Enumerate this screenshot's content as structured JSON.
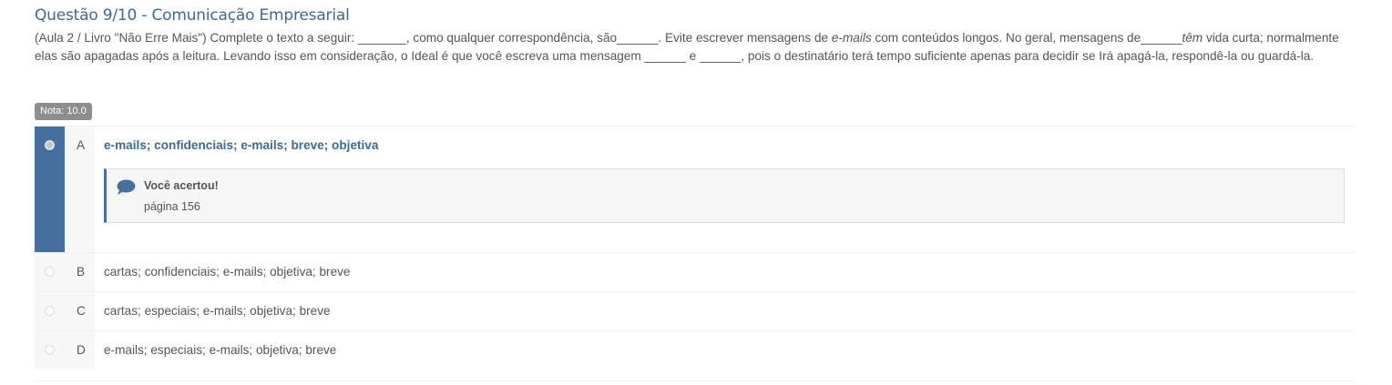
{
  "question": {
    "title": "Questão 9/10 - Comunicação Empresarial",
    "text_part1": "(Aula 2 / Livro \"Não Erre Mais\") Complete o texto a seguir:  _______, como qualquer correspondência, são______. Evite escrever mensagens de ",
    "text_em1": "e-mails",
    "text_part2": " com conteúdos longos. No geral, mensagens de______",
    "text_em2": "têm",
    "text_part3": " vida curta; normalmente elas são apagadas após a leitura. Levando isso em consideração, o Ideal é que você escreva uma mensagem ______ e ______, pois o destinatário terá tempo suficiente apenas para decidir se Irá apagá-la, respondê-la ou guardá-la."
  },
  "grade_badge": "Nota: 10.0",
  "options": [
    {
      "letter": "A",
      "text": "e-mails; confidenciais; e-mails; breve; objetiva",
      "selected": true
    },
    {
      "letter": "B",
      "text": "cartas; confidenciais; e-mails; objetiva; breve",
      "selected": false
    },
    {
      "letter": "C",
      "text": "cartas; especiais; e-mails; objetiva; breve",
      "selected": false
    },
    {
      "letter": "D",
      "text": "e-mails; especiais; e-mails; objetiva; breve",
      "selected": false
    }
  ],
  "feedback": {
    "icon": "comment-icon",
    "title": "Você acertou!",
    "text": "página 156"
  },
  "colors": {
    "accent": "#456f9e",
    "title": "#3d6a95",
    "badge": "#8d8d8d"
  }
}
